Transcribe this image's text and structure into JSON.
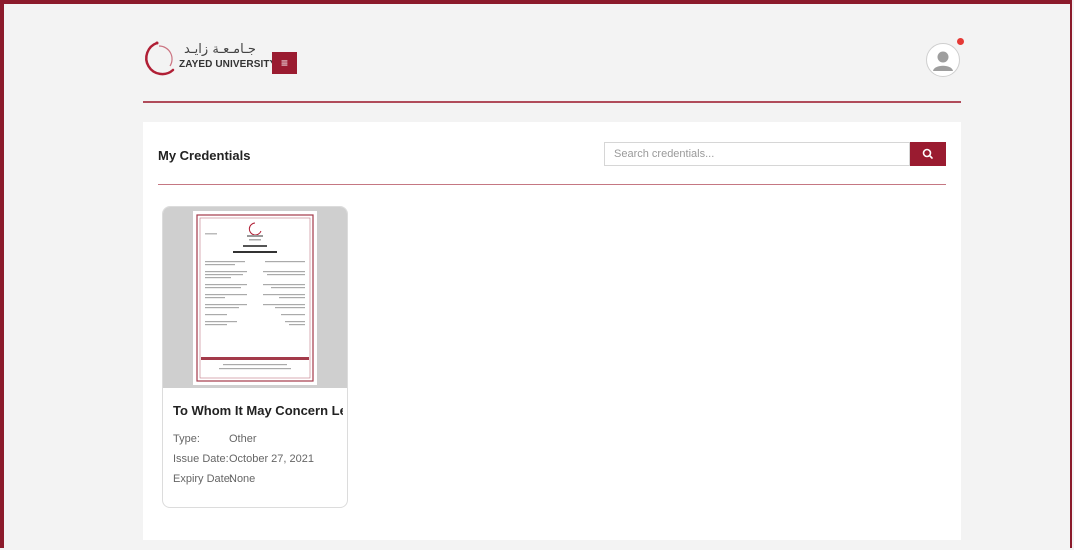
{
  "header": {
    "logo_arabic": "جـامـعـة زايـد",
    "logo_name": "ZAYED UNIVERSITY",
    "menu_glyph": "≡"
  },
  "panel": {
    "title": "My Credentials",
    "search": {
      "placeholder": "Search credentials...",
      "value": ""
    }
  },
  "credentials": [
    {
      "title": "To Whom It May Concern Let...",
      "type_label": "Type:",
      "type_value": "Other",
      "issue_label": "Issue Date:",
      "issue_value": "October 27, 2021",
      "expiry_label": "Expiry Date:",
      "expiry_value": "None"
    }
  ],
  "colors": {
    "brand": "#9a1b30",
    "frame": "#8b1a2b",
    "notification": "#e53935"
  }
}
